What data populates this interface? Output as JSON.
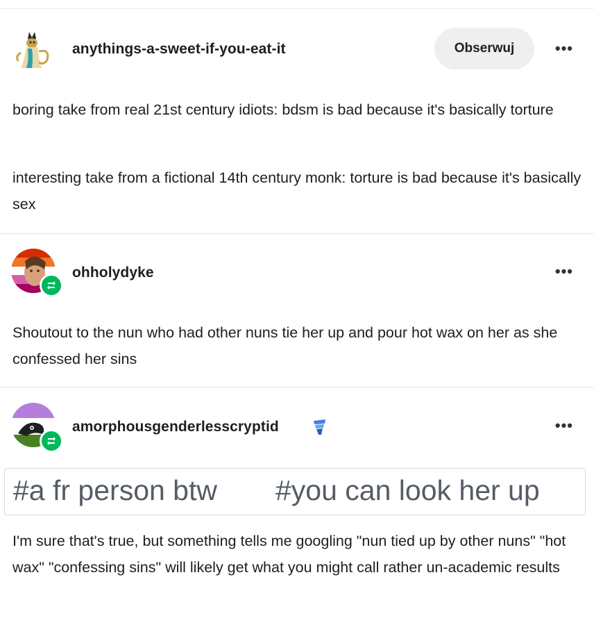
{
  "posts": [
    {
      "username": "anythings-a-sweet-if-you-eat-it",
      "follow_label": "Obserwuj",
      "more_label": "•••",
      "paragraphs": [
        "boring take from real 21st century idiots: bdsm is bad because it's basically torture",
        "interesting take from a fictional 14th century monk: torture is bad because it's basically sex"
      ]
    },
    {
      "username": "ohholydyke",
      "more_label": "•••",
      "paragraphs": [
        "Shoutout to the nun who had other nuns tie her up and pour hot wax on her as she confessed her sins"
      ]
    },
    {
      "username": "amorphousgenderlesscryptid",
      "more_label": "•••",
      "tags": [
        "#a fr person btw",
        "#you can look her up"
      ],
      "paragraphs": [
        "I'm sure that's true, but something tells me googling \"nun tied up by other nuns\" \"hot wax\" \"confessing sins\" will likely get what you might call rather un-academic results"
      ]
    }
  ],
  "icons": {
    "reblog": "reblog-icon",
    "verified": "blue-checkmark-icon"
  },
  "colors": {
    "reblog_badge": "#00b85c",
    "tag_text": "#555c66",
    "follow_bg": "#efefef"
  }
}
